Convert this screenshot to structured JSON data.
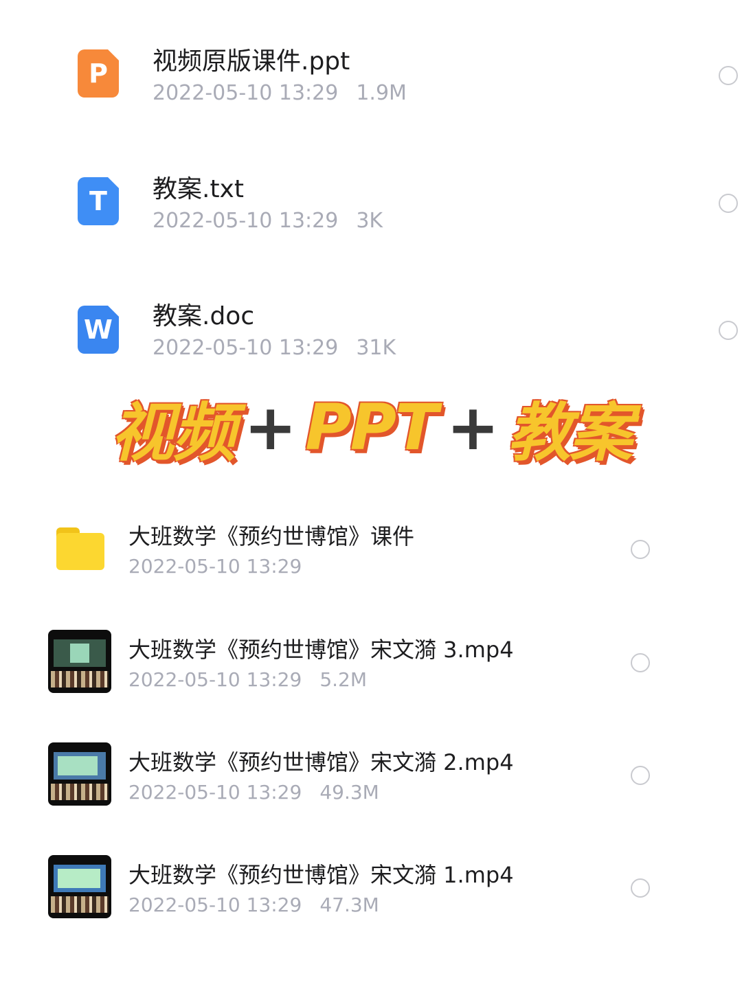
{
  "files_top": [
    {
      "icon": "ppt-file-icon",
      "icon_letter": "P",
      "name": "视频原版课件.ppt",
      "date": "2022-05-10 13:29",
      "size": "1.9M"
    },
    {
      "icon": "txt-file-icon",
      "icon_letter": "T",
      "name": "教案.txt",
      "date": "2022-05-10 13:29",
      "size": "3K"
    },
    {
      "icon": "doc-file-icon",
      "icon_letter": "W",
      "name": "教案.doc",
      "date": "2022-05-10 13:29",
      "size": "31K"
    }
  ],
  "banner": {
    "part1": "视频",
    "plus1": "+",
    "part2": "PPT",
    "plus2": "+",
    "part3": "教案"
  },
  "files_bottom": [
    {
      "icon": "folder-icon",
      "name": "大班数学《预约世博馆》课件",
      "date": "2022-05-10 13:29",
      "size": ""
    },
    {
      "icon": "video-thumbnail",
      "name": "大班数学《预约世博馆》宋文漪 3.mp4",
      "date": "2022-05-10 13:29",
      "size": "5.2M"
    },
    {
      "icon": "video-thumbnail",
      "name": "大班数学《预约世博馆》宋文漪 2.mp4",
      "date": "2022-05-10 13:29",
      "size": "49.3M"
    },
    {
      "icon": "video-thumbnail",
      "name": "大班数学《预约世博馆》宋文漪 1.mp4",
      "date": "2022-05-10 13:29",
      "size": "47.3M"
    }
  ],
  "colors": {
    "banner_yellow": "#f7c52c",
    "banner_outline": "#e2562b",
    "meta_gray": "#a9abb6",
    "ppt": "#f7893a",
    "txt": "#3f8ef5",
    "doc": "#3a86f0",
    "folder": "#fcd730"
  }
}
